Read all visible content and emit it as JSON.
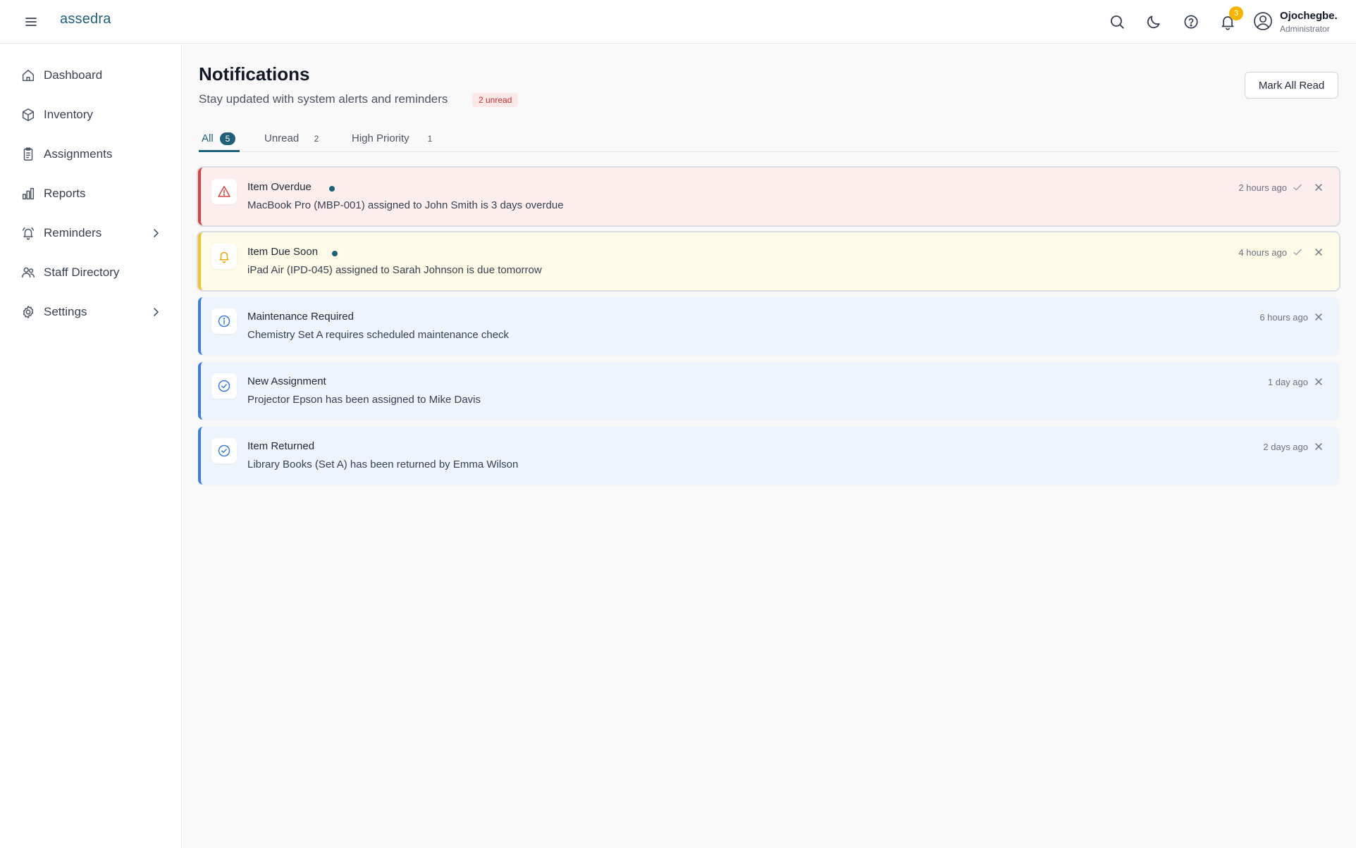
{
  "app": {
    "logo_text": "assedra"
  },
  "topbar": {
    "icons": [
      "search-icon",
      "moon-icon",
      "help-icon",
      "bell-icon"
    ],
    "notification_count": "3",
    "user": {
      "name": "Ojochegbe.",
      "role": "Administrator"
    }
  },
  "sidebar": {
    "items": [
      {
        "label": "Dashboard",
        "icon": "home-icon"
      },
      {
        "label": "Inventory",
        "icon": "box-icon"
      },
      {
        "label": "Assignments",
        "icon": "clipboard-icon"
      },
      {
        "label": "Reports",
        "icon": "bar-chart-icon"
      },
      {
        "label": "Reminders",
        "icon": "alarm-icon",
        "expandable": true
      },
      {
        "label": "Staff Directory",
        "icon": "users-icon"
      },
      {
        "label": "Settings",
        "icon": "gear-icon",
        "expandable": true
      }
    ]
  },
  "page": {
    "title": "Notifications",
    "subtitle": "Stay updated with system alerts and reminders",
    "unread_badge": "2 unread",
    "mark_all_label": "Mark All Read"
  },
  "tabs": [
    {
      "label": "All",
      "count": "5",
      "active": true
    },
    {
      "label": "Unread",
      "count": "2",
      "active": false
    },
    {
      "label": "High Priority",
      "count": "1",
      "active": false
    }
  ],
  "notifications": [
    {
      "title": "Item Overdue",
      "message": "MacBook Pro (MBP-001) assigned to John Smith is 3 days overdue",
      "time": "2 hours ago",
      "unread": true,
      "icon": "warning-triangle-icon",
      "colors": {
        "bg": "#fdeeee",
        "accent": "#d64545",
        "icon": "#d64545"
      }
    },
    {
      "title": "Item Due Soon",
      "message": "iPad Air (IPD-045) assigned to Sarah Johnson is due tomorrow",
      "time": "4 hours ago",
      "unread": true,
      "icon": "bell-icon",
      "colors": {
        "bg": "#fefbe8",
        "accent": "#f2c12e",
        "icon": "#e6a800"
      }
    },
    {
      "title": "Maintenance Required",
      "message": "Chemistry Set A requires scheduled maintenance check",
      "time": "6 hours ago",
      "unread": false,
      "icon": "info-circle-icon",
      "colors": {
        "bg": "#eef4fd",
        "accent": "#3b7ddd",
        "icon": "#3b7ddd"
      }
    },
    {
      "title": "New Assignment",
      "message": "Projector Epson has been assigned to Mike Davis",
      "time": "1 day ago",
      "unread": false,
      "icon": "check-circle-icon",
      "colors": {
        "bg": "#eef4fd",
        "accent": "#3b7ddd",
        "icon": "#3b7ddd"
      }
    },
    {
      "title": "Item Returned",
      "message": "Library Books (Set A) has been returned by Emma Wilson",
      "time": "2 days ago",
      "unread": false,
      "icon": "check-circle-icon",
      "colors": {
        "bg": "#eef4fd",
        "accent": "#3b7ddd",
        "icon": "#3b7ddd"
      }
    }
  ],
  "theme": {
    "primary": "#1f5f7a",
    "badge": "#f5b400"
  }
}
